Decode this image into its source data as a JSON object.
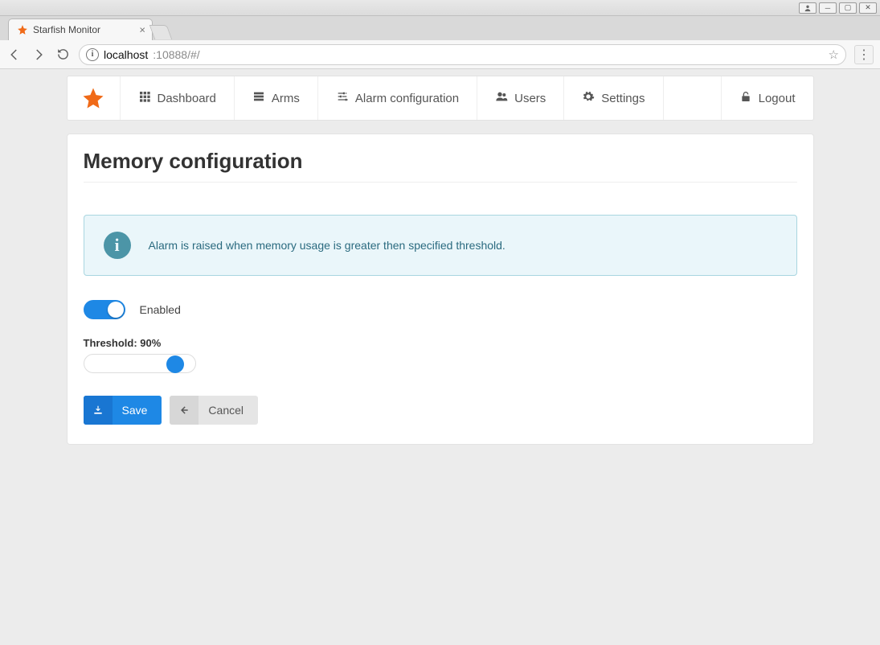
{
  "window": {
    "tab_title": "Starfish Monitor",
    "url_host": "localhost",
    "url_port_path": ":10888/#/"
  },
  "nav": {
    "dashboard": "Dashboard",
    "arms": "Arms",
    "alarm_config": "Alarm configuration",
    "users": "Users",
    "settings": "Settings",
    "logout": "Logout"
  },
  "page": {
    "title": "Memory configuration",
    "alert_text": "Alarm is raised when memory usage is greater then specified threshold.",
    "enabled_label": "Enabled",
    "threshold_label_prefix": "Threshold: ",
    "threshold_value": "90%",
    "save_label": "Save",
    "cancel_label": "Cancel"
  },
  "colors": {
    "accent": "#1e88e5",
    "brand": "#f06a18",
    "alert_bg": "#eaf6fa",
    "alert_border": "#a9d6e0",
    "alert_text": "#2a6a7f"
  }
}
